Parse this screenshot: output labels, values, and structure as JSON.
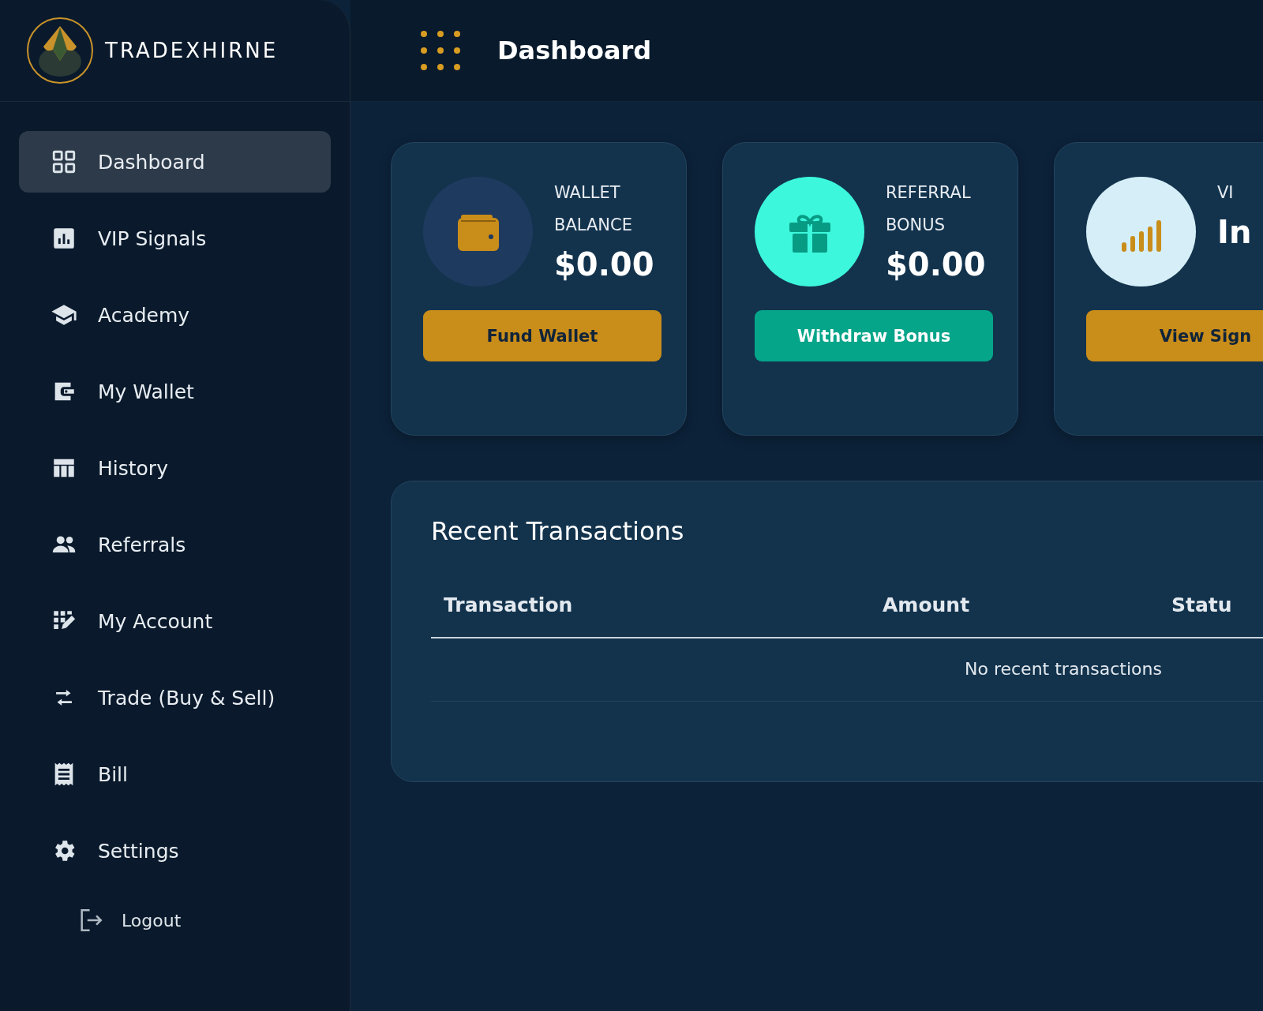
{
  "brand": {
    "name": "TRADEXHIRNE"
  },
  "header": {
    "title": "Dashboard"
  },
  "sidebar": {
    "items": [
      {
        "label": "Dashboard",
        "selected": true
      },
      {
        "label": "VIP Signals",
        "selected": false
      },
      {
        "label": "Academy",
        "selected": false
      },
      {
        "label": "My Wallet",
        "selected": false
      },
      {
        "label": "History",
        "selected": false
      },
      {
        "label": "Referrals",
        "selected": false
      },
      {
        "label": "My Account",
        "selected": false
      },
      {
        "label": "Trade (Buy & Sell)",
        "selected": false
      },
      {
        "label": "Bill",
        "selected": false
      },
      {
        "label": "Settings",
        "selected": false
      }
    ],
    "logout": {
      "label": "Logout"
    }
  },
  "cards": [
    {
      "kind": "wallet",
      "label_lines": [
        "WALLET",
        "BALANCE"
      ],
      "value": "$0.00",
      "button": "Fund Wallet"
    },
    {
      "kind": "bonus",
      "label_lines": [
        "REFERRAL",
        "BONUS"
      ],
      "value": "$0.00",
      "button": "Withdraw Bonus"
    },
    {
      "kind": "signals",
      "label_lines": [
        "VI"
      ],
      "value": "In",
      "button": "View Sign"
    }
  ],
  "transactions": {
    "title": "Recent Transactions",
    "columns": [
      "Transaction",
      "Amount",
      "Statu"
    ],
    "empty_message": "No recent transactions"
  }
}
